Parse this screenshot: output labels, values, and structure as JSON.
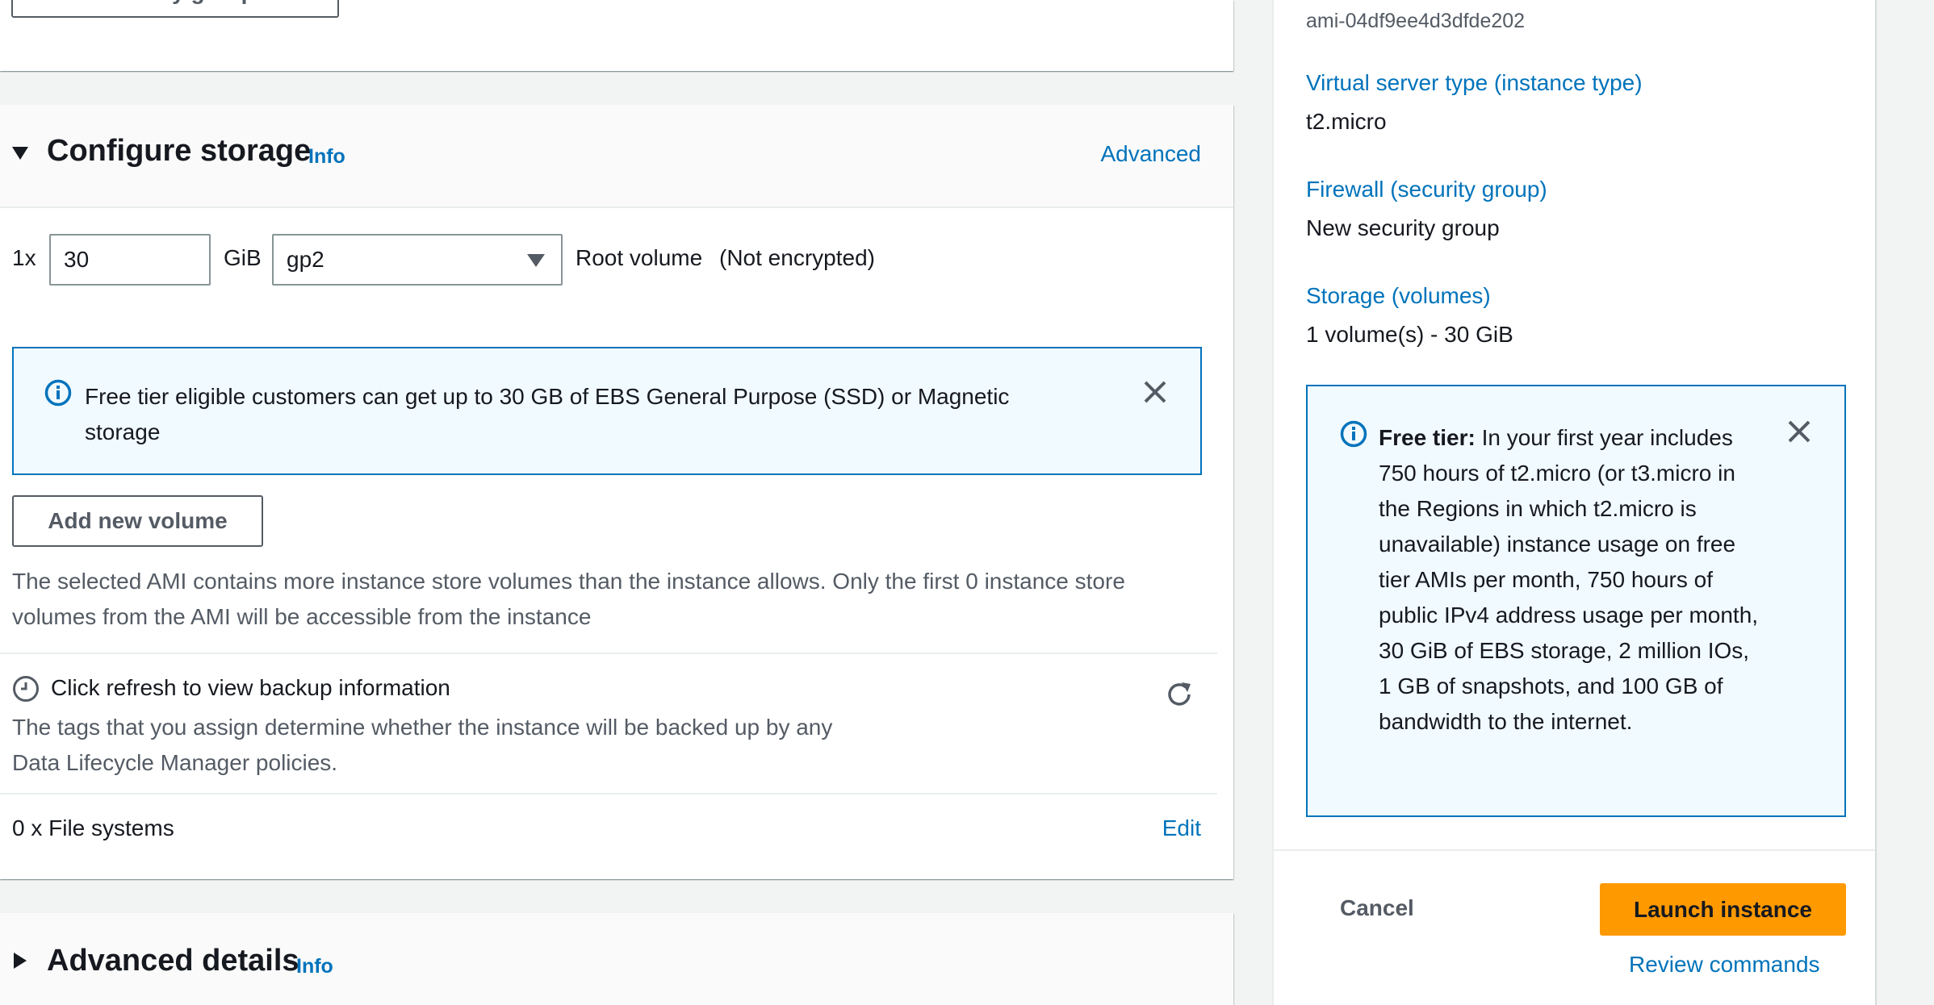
{
  "top": {
    "partial_button_label": "Add security group rule"
  },
  "storage": {
    "title": "Configure storage",
    "info": "Info",
    "advanced": "Advanced",
    "multiplier": "1x",
    "size_value": "30",
    "unit": "GiB",
    "volume_type": "gp2",
    "root_volume": "Root volume",
    "encryption": "(Not encrypted)",
    "alert_text": "Free tier eligible customers can get up to 30 GB of EBS General Purpose (SSD) or Magnetic storage",
    "add_volume": "Add new volume",
    "ami_note": "The selected AMI contains more instance store volumes than the instance allows. Only the first 0 instance store volumes from the AMI will be accessible from the instance",
    "backup_title": "Click refresh to view backup information",
    "backup_desc_line1": "The tags that you assign determine whether the instance will be backed up by any",
    "backup_desc_line2": "Data Lifecycle Manager policies.",
    "file_systems": "0 x File systems",
    "edit": "Edit"
  },
  "advanced": {
    "title": "Advanced details",
    "info": "Info"
  },
  "summary": {
    "ami_id": "ami-04df9ee4d3dfde202",
    "instance_type_label": "Virtual server type (instance type)",
    "instance_type_value": "t2.micro",
    "firewall_label": "Firewall (security group)",
    "firewall_value": "New security group",
    "storage_label": "Storage (volumes)",
    "storage_value": "1 volume(s) - 30 GiB",
    "free_tier_bold": "Free tier:",
    "free_tier_text": " In your first year includes 750 hours of t2.micro (or t3.micro in the Regions in which t2.micro is unavailable) instance usage on free tier AMIs per month, 750 hours of public IPv4 address usage per month, 30 GiB of EBS storage, 2 million IOs, 1 GB of snapshots, and 100 GB of bandwidth to the internet.",
    "cancel": "Cancel",
    "launch": "Launch instance",
    "review": "Review commands"
  },
  "icons": {
    "collapse": "caret-down-icon",
    "expand": "caret-right-icon",
    "dropdown": "caret-down-icon",
    "info": "info-circle-icon",
    "close": "close-icon",
    "clock": "clock-icon",
    "refresh": "refresh-icon"
  },
  "colors": {
    "link": "#0073bb",
    "primary_button": "#ff9900",
    "alert_bg": "#f1faff",
    "alert_border": "#0073bb",
    "page_bg": "#f2f3f3"
  }
}
